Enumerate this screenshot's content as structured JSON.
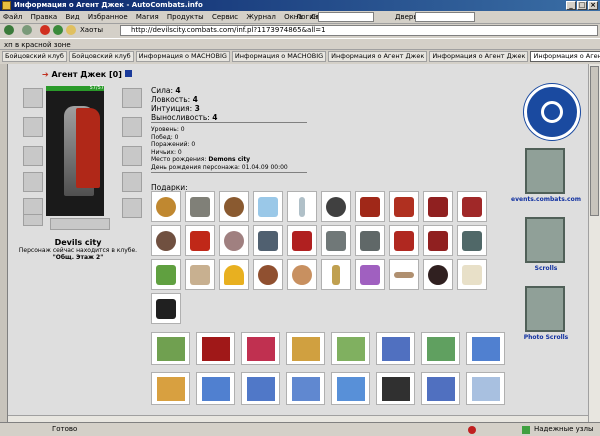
{
  "window": {
    "title": "Информация о Агент Джек - AutoCombats.info"
  },
  "menu": {
    "items": [
      "Файл",
      "Правка",
      "Вид",
      "Избранное",
      "Магия",
      "Продукты",
      "Сервис",
      "Журнал",
      "Окна",
      "Справка"
    ],
    "login_label": "Логин:",
    "door_label": "Дверь:"
  },
  "toolbar": {
    "favorites": "Хаоты",
    "address": "http://devilscity.combats.com/inf.pl?1173974865&all=1"
  },
  "links": {
    "item": "хп в красной зоне"
  },
  "tabs": [
    "Бойцовский клуб",
    "Бойцовский клуб",
    "Информация о MACHOBIG",
    "Информация о MACHOBIG",
    "Информация о Агент Джек",
    "Информация о Агент Джек",
    "Информация о Агент Джек"
  ],
  "character": {
    "name": "Агент Джек",
    "level": "[0]",
    "hp": "57/57",
    "city": "Devils city",
    "location_text": "Персонаж сейчас находится в клубе.",
    "location_room": "\"Общ. Этаж 2\""
  },
  "stats": {
    "strength_label": "Сила:",
    "strength": "4",
    "agility_label": "Ловкость:",
    "agility": "4",
    "intuition_label": "Интуиция:",
    "intuition": "3",
    "endurance_label": "Выносливость:",
    "endurance": "4"
  },
  "info": {
    "level": "Уровень: 0",
    "wins": "Побед: 0",
    "losses": "Поражений: 0",
    "draws": "Ничьих: 0",
    "birthplace_label": "Место рождения:",
    "birthplace": "Demons city",
    "birthday": "День рождения персонажа: 01.04.09 00:00"
  },
  "gifts_label": "Подарки:",
  "right": {
    "link1": "events.combats.com",
    "link2": "Scrolls",
    "link3": "Photo Scrolls"
  },
  "status": {
    "ready": "Готово",
    "zone": "Надежные узлы"
  },
  "colors": {
    "accent": "#0a246a",
    "hp": "#2a9a2a",
    "link": "#1030a0"
  }
}
